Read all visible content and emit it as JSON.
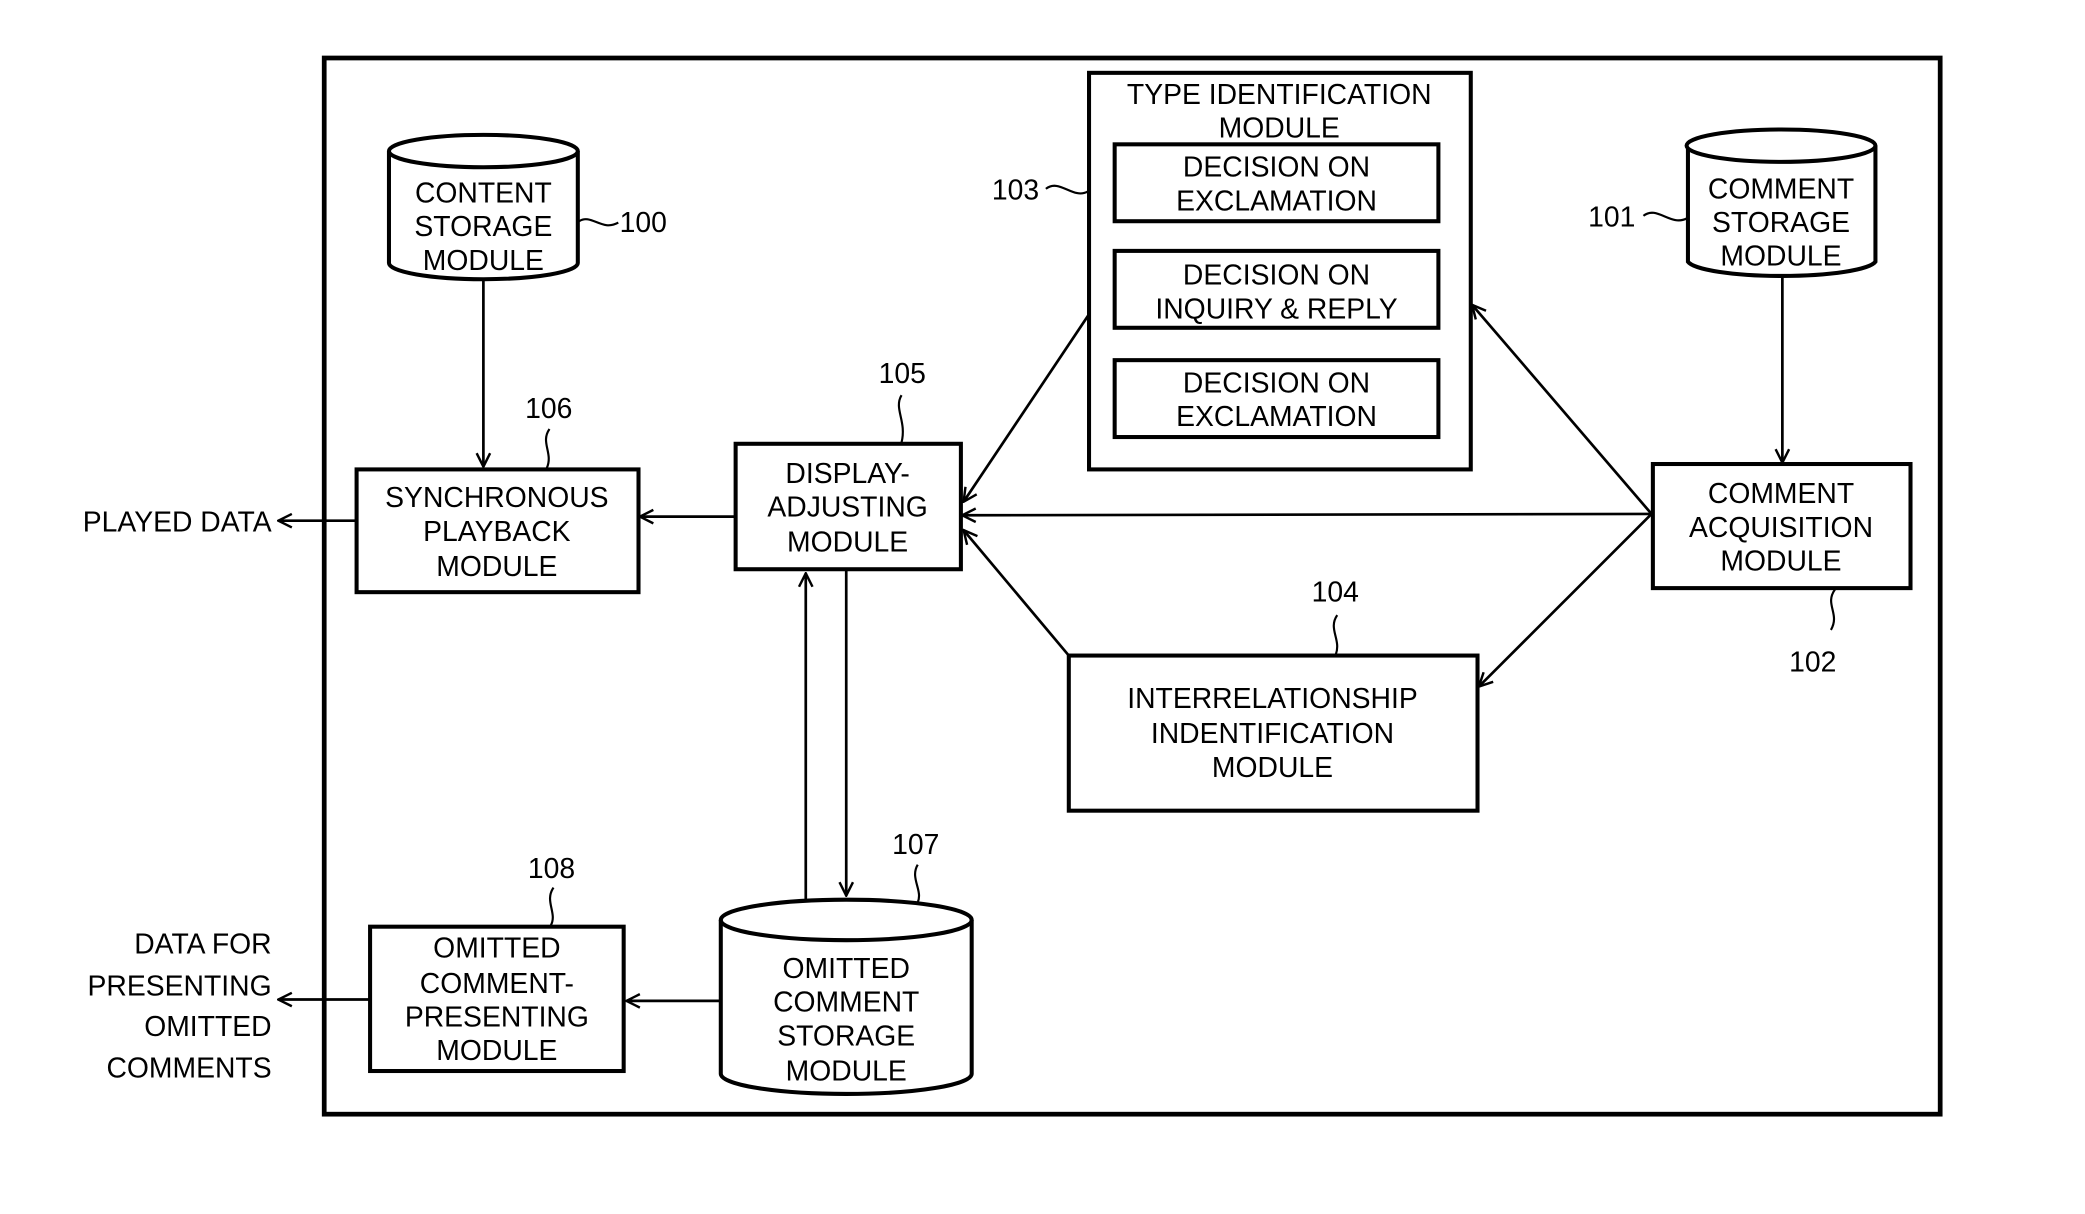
{
  "diagram": {
    "modules": {
      "content_storage": {
        "ref": "100",
        "lines": [
          "CONTENT",
          "STORAGE",
          "MODULE"
        ]
      },
      "comment_storage": {
        "ref": "101",
        "lines": [
          "COMMENT",
          "STORAGE",
          "MODULE"
        ]
      },
      "comment_acquisition": {
        "ref": "102",
        "lines": [
          "COMMENT",
          "ACQUISITION",
          "MODULE"
        ]
      },
      "type_identification": {
        "ref": "103",
        "lines": [
          "TYPE IDENTIFICATION",
          "MODULE"
        ],
        "sub_blocks": [
          {
            "lines": [
              "DECISION ON",
              "EXCLAMATION"
            ]
          },
          {
            "lines": [
              "DECISION ON",
              "INQUIRY & REPLY"
            ]
          },
          {
            "lines": [
              "DECISION ON",
              "EXCLAMATION"
            ]
          }
        ]
      },
      "interrelationship_identification": {
        "ref": "104",
        "lines": [
          "INTERRELATIONSHIP",
          "INDENTIFICATION",
          "MODULE"
        ]
      },
      "display_adjusting": {
        "ref": "105",
        "lines": [
          "DISPLAY-",
          "ADJUSTING",
          "MODULE"
        ]
      },
      "synchronous_playback": {
        "ref": "106",
        "lines": [
          "SYNCHRONOUS",
          "PLAYBACK",
          "MODULE"
        ]
      },
      "omitted_comment_storage": {
        "ref": "107",
        "lines": [
          "OMITTED",
          "COMMENT",
          "STORAGE",
          "MODULE"
        ]
      },
      "omitted_comment_presenting": {
        "ref": "108",
        "lines": [
          "OMITTED",
          "COMMENT-",
          "PRESENTING",
          "MODULE"
        ]
      }
    },
    "outputs": {
      "played_data": {
        "lines": [
          "PLAYED DATA"
        ]
      },
      "omitted_presenting_data": {
        "lines": [
          "DATA FOR",
          "PRESENTING",
          "OMITTED",
          "COMMENTS"
        ]
      }
    },
    "connections": [
      {
        "from": "content_storage",
        "to": "synchronous_playback"
      },
      {
        "from": "comment_storage",
        "to": "comment_acquisition"
      },
      {
        "from": "comment_acquisition",
        "to": "display_adjusting"
      },
      {
        "from": "comment_acquisition",
        "to": "type_identification"
      },
      {
        "from": "comment_acquisition",
        "to": "interrelationship_identification"
      },
      {
        "from": "type_identification",
        "to": "display_adjusting"
      },
      {
        "from": "interrelationship_identification",
        "to": "display_adjusting"
      },
      {
        "from": "display_adjusting",
        "to": "synchronous_playback"
      },
      {
        "from": "display_adjusting",
        "to": "omitted_comment_storage"
      },
      {
        "from": "omitted_comment_storage",
        "to": "display_adjusting"
      },
      {
        "from": "omitted_comment_storage",
        "to": "omitted_comment_presenting"
      },
      {
        "from": "synchronous_playback",
        "to": "played_data"
      },
      {
        "from": "omitted_comment_presenting",
        "to": "omitted_presenting_data"
      }
    ]
  }
}
